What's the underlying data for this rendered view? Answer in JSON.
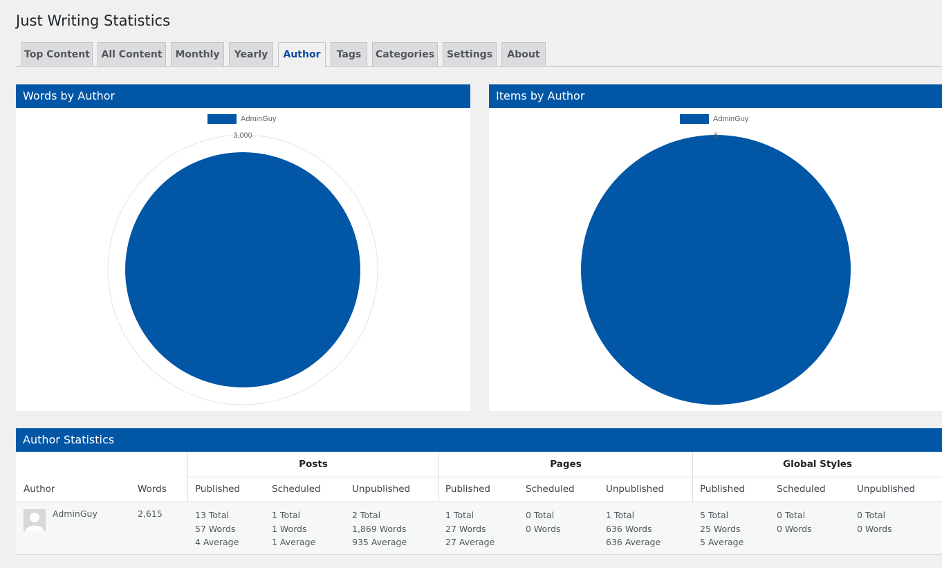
{
  "page": {
    "title": "Just Writing Statistics"
  },
  "tabs": [
    {
      "label": "Top Content"
    },
    {
      "label": "All Content"
    },
    {
      "label": "Monthly"
    },
    {
      "label": "Yearly"
    },
    {
      "label": "Author",
      "active": true
    },
    {
      "label": "Tags"
    },
    {
      "label": "Categories"
    },
    {
      "label": "Settings"
    },
    {
      "label": "About"
    }
  ],
  "colors": {
    "brand": "#0156a5",
    "active_tab_text": "#0a4b9b"
  },
  "words_chart": {
    "title": "Words by Author",
    "chart_data": {
      "type": "pie",
      "series": [
        {
          "name": "AdminGuy",
          "values": [
            2615
          ]
        }
      ],
      "labels": [
        "AdminGuy"
      ],
      "radial_axis_max_label": "3,000"
    }
  },
  "items_chart": {
    "title": "Items by Author",
    "chart_data": {
      "type": "pie",
      "series": [
        {
          "name": "AdminGuy",
          "values": [
            6
          ]
        }
      ],
      "labels": [
        "AdminGuy"
      ],
      "radial_axis_max_label": "6"
    }
  },
  "stats": {
    "title": "Author Statistics",
    "groups": [
      "Posts",
      "Pages",
      "Global Styles"
    ],
    "col_author": "Author",
    "col_words": "Words",
    "sub_cols": [
      "Published",
      "Scheduled",
      "Unpublished"
    ],
    "rows": [
      {
        "author": "AdminGuy",
        "avatar_icon": "user-avatar-icon",
        "words": "2,615",
        "posts": {
          "published": [
            "13 Total",
            "57 Words",
            "4 Average"
          ],
          "scheduled": [
            "1 Total",
            "1 Words",
            "1 Average"
          ],
          "unpublished": [
            "2 Total",
            "1,869 Words",
            "935 Average"
          ]
        },
        "pages": {
          "published": [
            "1 Total",
            "27 Words",
            "27 Average"
          ],
          "scheduled": [
            "0 Total",
            "0 Words"
          ],
          "unpublished": [
            "1 Total",
            "636 Words",
            "636 Average"
          ]
        },
        "global_styles": {
          "published": [
            "5 Total",
            "25 Words",
            "5 Average"
          ],
          "scheduled": [
            "0 Total",
            "0 Words"
          ],
          "unpublished": [
            "0 Total",
            "0 Words"
          ]
        }
      }
    ]
  }
}
